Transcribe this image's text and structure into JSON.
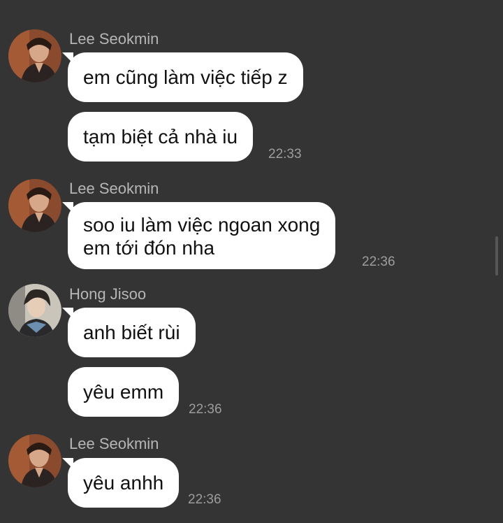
{
  "groups": [
    {
      "sender": "Lee Seokmin",
      "avatar": "lee-seokmin-avatar",
      "messages": [
        "em cũng làm việc tiếp z",
        "tạm biệt cả nhà iu"
      ],
      "time": "22:33"
    },
    {
      "sender": "Lee Seokmin",
      "avatar": "lee-seokmin-avatar",
      "messages": [
        [
          "soo iu làm việc ngoan xong",
          "em tới đón nha"
        ]
      ],
      "time": "22:36"
    },
    {
      "sender": "Hong Jisoo",
      "avatar": "hong-jisoo-avatar",
      "messages": [
        "anh biết rùi",
        "yêu emm"
      ],
      "time": "22:36"
    },
    {
      "sender": "Lee Seokmin",
      "avatar": "lee-seokmin-avatar",
      "messages": [
        "yêu anhh"
      ],
      "time": "22:36"
    }
  ],
  "colors": {
    "background": "#333433",
    "bubble": "#ffffff",
    "sender_name": "#b5b6b5",
    "timestamp": "#9c9d9c"
  }
}
